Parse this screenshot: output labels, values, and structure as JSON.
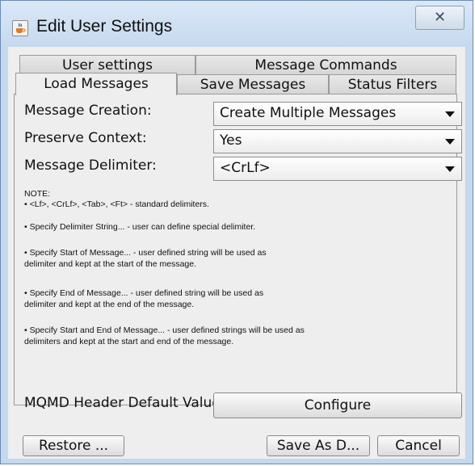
{
  "window": {
    "title": "Edit User Settings",
    "app_icon": "java-cup-icon",
    "close_glyph": "✕"
  },
  "tabs": {
    "row1": [
      {
        "label": "User settings"
      },
      {
        "label": "Message Commands"
      }
    ],
    "row2": [
      {
        "label": "Load Messages",
        "active": true
      },
      {
        "label": "Save Messages"
      },
      {
        "label": "Status Filters"
      }
    ]
  },
  "form": {
    "message_creation": {
      "label": "Message Creation:",
      "value": "Create Multiple Messages"
    },
    "preserve_context": {
      "label": "Preserve Context:",
      "value": "Yes"
    },
    "message_delimiter": {
      "label": "Message Delimiter:",
      "value": "<CrLf>"
    }
  },
  "notes": {
    "heading": "NOTE:",
    "lines": [
      "• <Lf>, <CrLf>, <Tab>, <Ft> - standard delimiters.",
      "• Specify Delimiter String... - user can define special delimiter.",
      "• Specify Start of Message... - user defined string will be used as",
      "delimiter and kept at the start of the message.",
      "• Specify End of Message... - user defined string will be used as",
      "delimiter and kept at the end of the message.",
      "• Specify Start and End of Message... - user defined strings will be used as",
      "delimiters and kept at the start and end of the message."
    ]
  },
  "mqmd": {
    "label": "MQMD Header Default Values",
    "button": "Configure"
  },
  "footer": {
    "restore": "Restore ...",
    "save_as": "Save As D...",
    "cancel": "Cancel"
  }
}
